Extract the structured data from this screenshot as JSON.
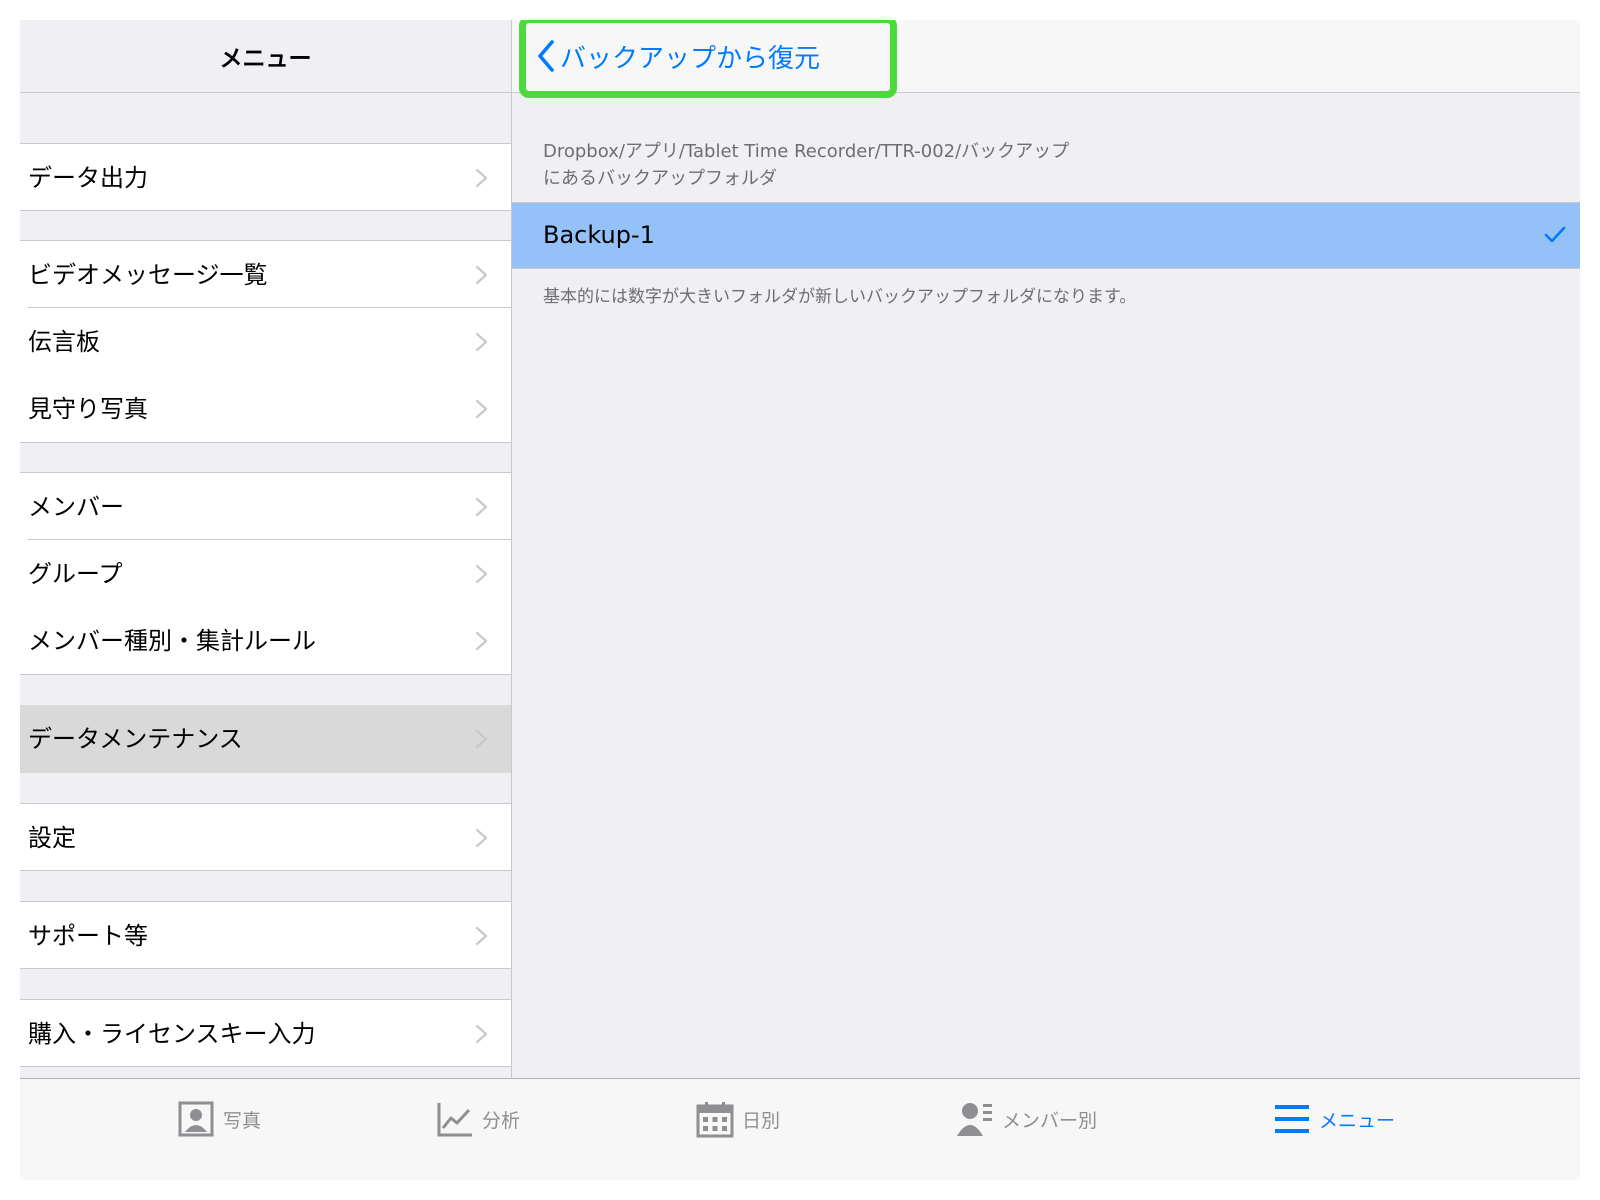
{
  "left_nav": {
    "title": "メニュー"
  },
  "menu_items": [
    {
      "label": "データ出力"
    },
    {
      "label": "ビデオメッセージ一覧"
    },
    {
      "label": "伝言板"
    },
    {
      "label": "見守り写真"
    },
    {
      "label": "メンバー"
    },
    {
      "label": "グループ"
    },
    {
      "label": "メンバー種別・集計ルール"
    },
    {
      "label": "データメンテナンス",
      "selected": true
    },
    {
      "label": "設定"
    },
    {
      "label": "サポート等"
    },
    {
      "label": "購入・ライセンスキー入力"
    }
  ],
  "detail": {
    "back_label": "バックアップから復元",
    "section_header_line1": "Dropbox/アプリ/Tablet Time Recorder/TTR-002/バックアップ",
    "section_header_line2": "にあるバックアップフォルダ",
    "backups": [
      {
        "label": "Backup-1",
        "checked": true
      }
    ],
    "footer_note": "基本的には数字が大きいフォルダが新しいバックアップフォルダになります。"
  },
  "tab_bar": {
    "tabs": [
      {
        "label": "写真",
        "icon": "photo-portrait-icon"
      },
      {
        "label": "分析",
        "icon": "line-chart-icon"
      },
      {
        "label": "日別",
        "icon": "calendar-icon"
      },
      {
        "label": "メンバー別",
        "icon": "member-list-icon"
      },
      {
        "label": "メニュー",
        "icon": "hamburger-menu-icon",
        "active": true
      }
    ]
  },
  "colors": {
    "accent": "#007aff",
    "selected_row": "#95c1f9",
    "highlight_outline": "#4cd93c",
    "background": "#efeff4"
  }
}
